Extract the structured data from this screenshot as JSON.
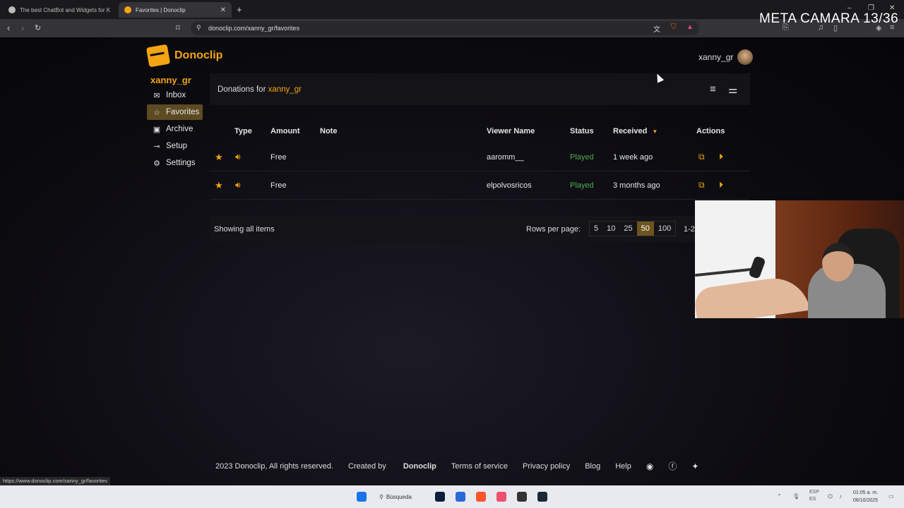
{
  "browser": {
    "tabs": [
      {
        "title": "The best ChatBot and Widgets for Ki",
        "close": ""
      },
      {
        "title": "Favorites | Donoclip",
        "close": "✕"
      }
    ],
    "new_tab": "+",
    "url": "donoclip.com/xanny_gr/favorites",
    "overlay_text": "META CAMARA 13/36",
    "status_url": "https://www.donoclip.com/xanny_gr/favorites"
  },
  "header": {
    "brand": "Donoclip",
    "username": "xanny_gr"
  },
  "sidebar": {
    "user": "xanny_gr",
    "items": [
      {
        "label": "Inbox",
        "icon": "✉"
      },
      {
        "label": "Favorites",
        "icon": "☆"
      },
      {
        "label": "Archive",
        "icon": "▣"
      },
      {
        "label": "Setup",
        "icon": "⊸"
      },
      {
        "label": "Settings",
        "icon": "⚙"
      }
    ]
  },
  "panel": {
    "title_prefix": "Donations for ",
    "title_user": "xanny_gr"
  },
  "table": {
    "headers": {
      "type": "Type",
      "amount": "Amount",
      "note": "Note",
      "viewer": "Viewer Name",
      "status": "Status",
      "received": "Received",
      "received_sort": "▼",
      "actions": "Actions"
    },
    "rows": [
      {
        "amount": "Free",
        "note": "",
        "viewer": "aaromm__",
        "status": "Played",
        "received": "1 week ago"
      },
      {
        "amount": "Free",
        "note": "",
        "viewer": "elpolvosricos",
        "status": "Played",
        "received": "3 months ago"
      }
    ]
  },
  "pagination": {
    "showing": "Showing all items",
    "rows_per_page_label": "Rows per page:",
    "options": [
      "5",
      "10",
      "25",
      "50",
      "100"
    ],
    "selected": "50",
    "range": "1-2"
  },
  "footer": {
    "copyright": "2023 Donoclip, All rights reserved.",
    "created_by_prefix": "Created by ",
    "created_by": "Donoclip",
    "links": [
      "Terms of service",
      "Privacy policy",
      "Blog",
      "Help"
    ]
  },
  "taskbar": {
    "search": "Búsqueda",
    "lang1": "ESP",
    "lang2": "ES",
    "time": "01:05 a. m.",
    "date": "06/10/2025"
  },
  "colors": {
    "accent": "#f2a414",
    "played": "#4cae4c",
    "active_bg": "#5c4a22"
  }
}
